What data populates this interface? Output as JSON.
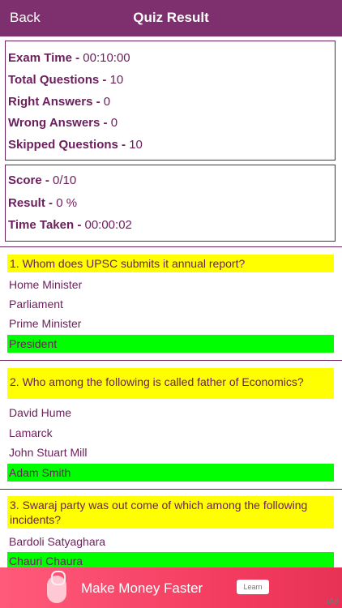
{
  "nav": {
    "back_label": "Back",
    "title": "Quiz Result"
  },
  "summary": {
    "exam_time": {
      "label": "Exam Time - ",
      "value": "00:10:00"
    },
    "total_questions": {
      "label": "Total Questions - ",
      "value": "10"
    },
    "right_answers": {
      "label": "Right Answers - ",
      "value": "0"
    },
    "wrong_answers": {
      "label": "Wrong Answers - ",
      "value": "0"
    },
    "skipped_questions": {
      "label": "Skipped Questions - ",
      "value": "10"
    }
  },
  "score": {
    "score": {
      "label": "Score - ",
      "value": "0/10"
    },
    "result": {
      "label": "Result - ",
      "value": "0 %"
    },
    "time_taken": {
      "label": "Time Taken - ",
      "value": "00:00:02"
    }
  },
  "questions": [
    {
      "text": "1. Whom does UPSC submits it annual report?",
      "options": [
        "Home Minister",
        "Parliament",
        "Prime Minister",
        "President"
      ],
      "correct_index": 3
    },
    {
      "text": "2. Who among the following is called father of Economics?",
      "options": [
        "David Hume",
        "Lamarck",
        "John Stuart Mill",
        "Adam Smith"
      ],
      "correct_index": 3
    },
    {
      "text": "3. Swaraj party was out come of which among the following incidents?",
      "options": [
        "Bardoli Satyaghara",
        "Chauri Chaura"
      ],
      "correct_index": 1
    }
  ],
  "ad": {
    "text": "Make Money Faster",
    "button": "Learn More",
    "tag": "iAd"
  },
  "colors": {
    "nav_bg": "#7d2f6e",
    "question_bg": "#ffff00",
    "correct_bg": "#00ff00",
    "text": "#6b1e5c"
  }
}
